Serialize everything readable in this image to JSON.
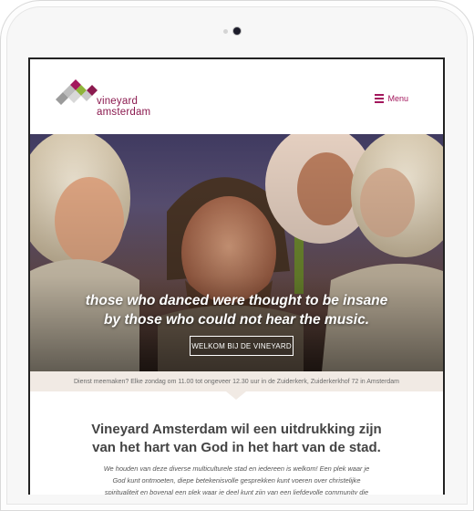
{
  "brand": {
    "line1": "vineyard",
    "line2": "amsterdam",
    "colors": {
      "primary": "#8b1a4f",
      "accent": "#a3175d",
      "green": "#8fb43a"
    }
  },
  "header": {
    "menu_label": "Menu",
    "menu_icon": "hamburger-icon"
  },
  "hero": {
    "quote_line1": "those who danced were thought to be insane",
    "quote_line2": "by those who could not hear the music.",
    "cta_label": "WELKOM BIJ DE VINEYARD"
  },
  "info_strip": {
    "text": "Dienst meemaken? Elke zondag om 11.00 tot ongeveer 12.30 uur in de Zuiderkerk, Zuiderkerkhof 72 in Amsterdam"
  },
  "intro": {
    "title_line1": "Vineyard Amsterdam wil een uitdrukking zijn",
    "title_line2": "van het hart van God in het hart van de stad.",
    "body_line1": "We houden van deze diverse multiculturele stad en iedereen is welkom! Een plek waar je",
    "body_line2": "God kunt ontmoeten, diepe betekenisvolle gesprekken kunt voeren over christelijke",
    "body_line3": "spiritualiteit en bovenal een plek waar je deel kunt zijn van een liefdevolle community die"
  }
}
